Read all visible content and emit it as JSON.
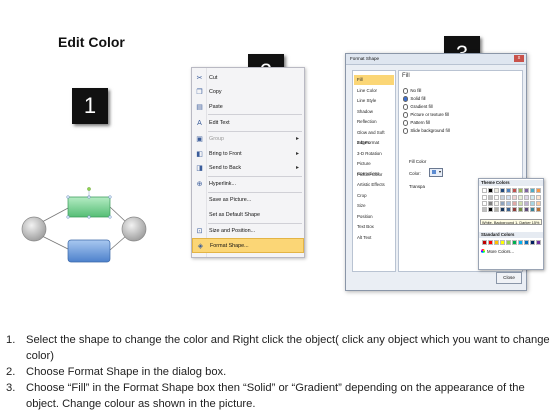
{
  "page_title": "Edit Color",
  "steps": [
    "1",
    "2",
    "3"
  ],
  "context_menu": {
    "items": [
      {
        "label": "Cut",
        "icon": "scissors-icon",
        "glyph": "✂"
      },
      {
        "label": "Copy",
        "icon": "copy-icon",
        "glyph": "❐"
      },
      {
        "label": "Paste",
        "icon": "paste-icon",
        "glyph": "▤"
      },
      {
        "label": "Edit Text",
        "icon": "edit-text-icon",
        "glyph": "A"
      },
      {
        "label": "Group",
        "icon": "group-icon",
        "glyph": "▣",
        "disabled": true,
        "submenu": true
      },
      {
        "label": "Bring to Front",
        "icon": "bring-front-icon",
        "glyph": "◧",
        "submenu": true
      },
      {
        "label": "Send to Back",
        "icon": "send-back-icon",
        "glyph": "◨",
        "submenu": true
      },
      {
        "label": "Hyperlink...",
        "icon": "hyperlink-icon",
        "glyph": "⊕"
      },
      {
        "label": "Save as Picture...",
        "icon": "",
        "glyph": ""
      },
      {
        "label": "Set as Default Shape",
        "icon": "",
        "glyph": ""
      },
      {
        "label": "Size and Position...",
        "icon": "size-position-icon",
        "glyph": "⊡"
      },
      {
        "label": "Format Shape...",
        "icon": "format-shape-icon",
        "glyph": "◈",
        "highlighted": true
      }
    ]
  },
  "format_dialog": {
    "title": "Format Shape",
    "close_glyph": "x",
    "nav_items": [
      "Fill",
      "Line Color",
      "Line Style",
      "Shadow",
      "Reflection",
      "Glow and Soft Edges",
      "3-D Format",
      "3-D Rotation",
      "Picture Corrections",
      "Picture Color",
      "Artistic Effects",
      "Crop",
      "Size",
      "Position",
      "Text Box",
      "Alt Text"
    ],
    "fill_heading": "Fill",
    "fill_options": [
      {
        "label": "No fill",
        "checked": false
      },
      {
        "label": "Solid fill",
        "checked": true
      },
      {
        "label": "Gradient fill",
        "checked": false
      },
      {
        "label": "Picture or texture fill",
        "checked": false
      },
      {
        "label": "Pattern fill",
        "checked": false
      },
      {
        "label": "Slide background fill",
        "checked": false
      }
    ],
    "fill_color_label": "Fill Color",
    "color_label": "Color:",
    "transparency_label": "Transpa",
    "theme_colors_label": "Theme Colors",
    "tooltip": "White, Background 1, Darker 15%",
    "standard_colors_label": "Standard Colors",
    "more_colors": "More Colors...",
    "close_button": "Close",
    "theme_top_row": [
      "#ffffff",
      "#000000",
      "#eeece1",
      "#1f497d",
      "#4f81bd",
      "#c0504d",
      "#9bbb59",
      "#8064a2",
      "#4bacc6",
      "#f79646"
    ],
    "standard_colors": [
      "#c00000",
      "#ff0000",
      "#ffc000",
      "#ffff00",
      "#92d050",
      "#00b050",
      "#00b0f0",
      "#0070c0",
      "#002060",
      "#7030a0"
    ]
  },
  "colors": {
    "highlight": "#fbd676",
    "shape_green": "#7ed39a",
    "shape_blue": "#6f9fdc"
  },
  "instructions": [
    {
      "num": "1.",
      "text": "Select the shape to change the color and Right click the object( click any object which you want to change color)"
    },
    {
      "num": "2.",
      "text": "Choose Format Shape in the dialog box."
    },
    {
      "num": "3.",
      "text": "Choose “Fill” in the Format Shape box then “Solid” or “Gradient” depending on the appearance of the object. Change colour as shown in the picture."
    }
  ]
}
